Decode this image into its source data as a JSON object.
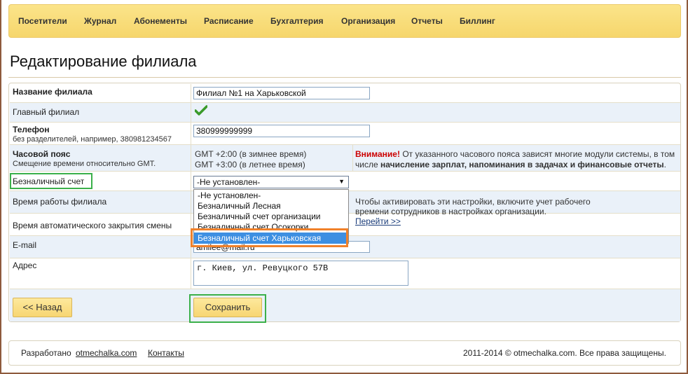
{
  "nav": {
    "items": [
      "Посетители",
      "Журнал",
      "Абонементы",
      "Расписание",
      "Бухгалтерия",
      "Организация",
      "Отчеты",
      "Биллинг"
    ]
  },
  "page_title": "Редактирование филиала",
  "form": {
    "branch_name": {
      "label": "Название филиала",
      "value": "Филиал №1 на Харьковской"
    },
    "main_branch": {
      "label": "Главный филиал",
      "icon": "check-icon"
    },
    "phone": {
      "label": "Телефон",
      "hint": "без разделителей, например, 380981234567",
      "value": "380999999999"
    },
    "timezone": {
      "label": "Часовой пояс",
      "hint": "Смещение времени относительно GMT.",
      "winter": "GMT +2:00 (в зимнее время)",
      "summer": "GMT +3:00 (в летнее время)",
      "warning_title": "Внимание!",
      "warning_text_1": "От указанного часового пояса зависят многие модули системы, в том",
      "warning_text_2": "числе",
      "warning_bold": "начисление зарплат, напоминания в задачах и финансовые отчеты",
      "warning_end": "."
    },
    "cashless": {
      "label": "Безналичный счет",
      "selected": "-Не установлен-",
      "options": [
        "-Не установлен-",
        "Безналичный Лесная",
        "Безналичный счет организации",
        "Безналичный счет Осокорки",
        "Безналичный счет Харьковская"
      ],
      "highlighted_index": 4
    },
    "work_time": {
      "label": "Время работы филиала",
      "note_1": "Чтобы активировать эти настройки, включите учет рабочего",
      "note_2": "времени сотрудников в настройках организации.",
      "link": "Перейти >>"
    },
    "auto_close": {
      "label": "Время автоматического закрытия смены"
    },
    "email": {
      "label": "E-mail",
      "value": "amilee@mail.ru"
    },
    "address": {
      "label": "Адрес",
      "value": "г. Киев, ул. Ревуцкого 57В"
    }
  },
  "buttons": {
    "back": "<< Назад",
    "save": "Сохранить"
  },
  "footer": {
    "developed": "Разработано",
    "dev_link": "otmechalka.com",
    "contacts": "Контакты",
    "copyright": "2011-2014 © otmechalka.com. Все права защищены."
  },
  "colors": {
    "nav_bg": "#f6d66c",
    "highlight_green": "#3bb04a",
    "highlight_orange": "#f0812a",
    "option_selected": "#3d8fe2",
    "warning_red": "#cc0000"
  }
}
